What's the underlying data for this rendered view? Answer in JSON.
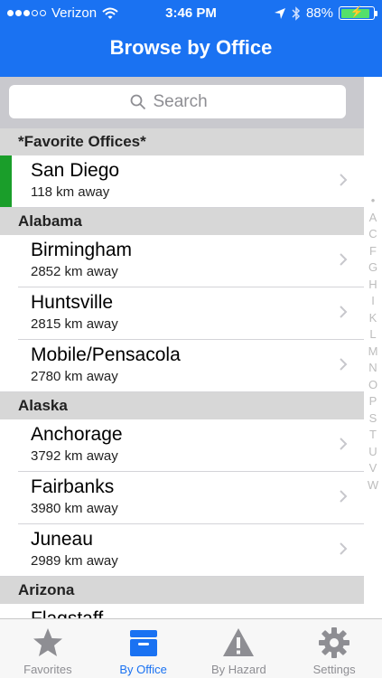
{
  "status_bar": {
    "carrier": "Verizon",
    "time": "3:46 PM",
    "battery": "88%",
    "battery_level": 0.88
  },
  "nav": {
    "title": "Browse by Office"
  },
  "search": {
    "placeholder": "Search"
  },
  "sections": [
    {
      "header": "*Favorite Offices*",
      "rows": [
        {
          "name": "San Diego",
          "distance": "118 km away",
          "favorite": true
        }
      ]
    },
    {
      "header": "Alabama",
      "rows": [
        {
          "name": "Birmingham",
          "distance": "2852 km away"
        },
        {
          "name": "Huntsville",
          "distance": "2815 km away"
        },
        {
          "name": "Mobile/Pensacola",
          "distance": "2780 km away"
        }
      ]
    },
    {
      "header": "Alaska",
      "rows": [
        {
          "name": "Anchorage",
          "distance": "3792 km away"
        },
        {
          "name": "Fairbanks",
          "distance": "3980 km away"
        },
        {
          "name": "Juneau",
          "distance": "2989 km away"
        }
      ]
    },
    {
      "header": "Arizona",
      "rows": [
        {
          "name": "Flagstaff",
          "distance": ""
        }
      ]
    }
  ],
  "index_letters": [
    "•",
    "A",
    "C",
    "F",
    "G",
    "H",
    "I",
    "K",
    "L",
    "M",
    "N",
    "O",
    "P",
    "S",
    "T",
    "U",
    "V",
    "W"
  ],
  "tabs": [
    {
      "label": "Favorites",
      "icon": "star-icon",
      "active": false
    },
    {
      "label": "By Office",
      "icon": "inbox-tray-icon",
      "active": true
    },
    {
      "label": "By Hazard",
      "icon": "warning-icon",
      "active": false
    },
    {
      "label": "Settings",
      "icon": "gear-icon",
      "active": false
    }
  ],
  "colors": {
    "nav_bar": "#1a72f2",
    "favorite_marker": "#1a9e2a",
    "active_tab": "#1a72f2",
    "inactive_tab": "#8e8e93"
  }
}
